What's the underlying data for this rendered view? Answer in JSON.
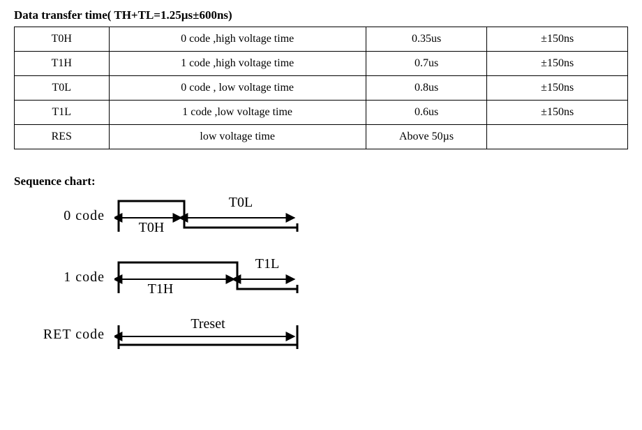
{
  "title_prefix": "Data transfer time",
  "title_suffix": "( TH+TL=1.25µs±600ns)",
  "table": {
    "rows": [
      {
        "symbol": "T0H",
        "desc": "0 code ,high voltage time",
        "value": "0.35us",
        "tolerance": "±150ns"
      },
      {
        "symbol": "T1H",
        "desc": "1 code ,high voltage time",
        "value": "0.7us",
        "tolerance": "±150ns"
      },
      {
        "symbol": "T0L",
        "desc": "0 code , low voltage time",
        "value": "0.8us",
        "tolerance": "±150ns"
      },
      {
        "symbol": "T1L",
        "desc": "1 code ,low voltage time",
        "value": "0.6us",
        "tolerance": "±150ns"
      },
      {
        "symbol": "RES",
        "desc": "low voltage time",
        "value": "Above 50µs",
        "tolerance": ""
      }
    ]
  },
  "sequence_title": "Sequence chart:",
  "sequence": {
    "zero_label": "0 code",
    "one_label": "1 code",
    "ret_label": "RET code",
    "t0h": "T0H",
    "t0l": "T0L",
    "t1h": "T1H",
    "t1l": "T1L",
    "treset": "Treset"
  },
  "chart_data": {
    "type": "table",
    "rows": [
      [
        "T0H",
        "0 code ,high voltage time",
        "0.35us",
        "±150ns"
      ],
      [
        "T1H",
        "1 code ,high voltage time",
        "0.7us",
        "±150ns"
      ],
      [
        "T0L",
        "0 code , low voltage time",
        "0.8us",
        "±150ns"
      ],
      [
        "T1L",
        "1 code ,low voltage time",
        "0.6us",
        "±150ns"
      ],
      [
        "RES",
        "low voltage time",
        "Above 50µs",
        ""
      ]
    ]
  }
}
